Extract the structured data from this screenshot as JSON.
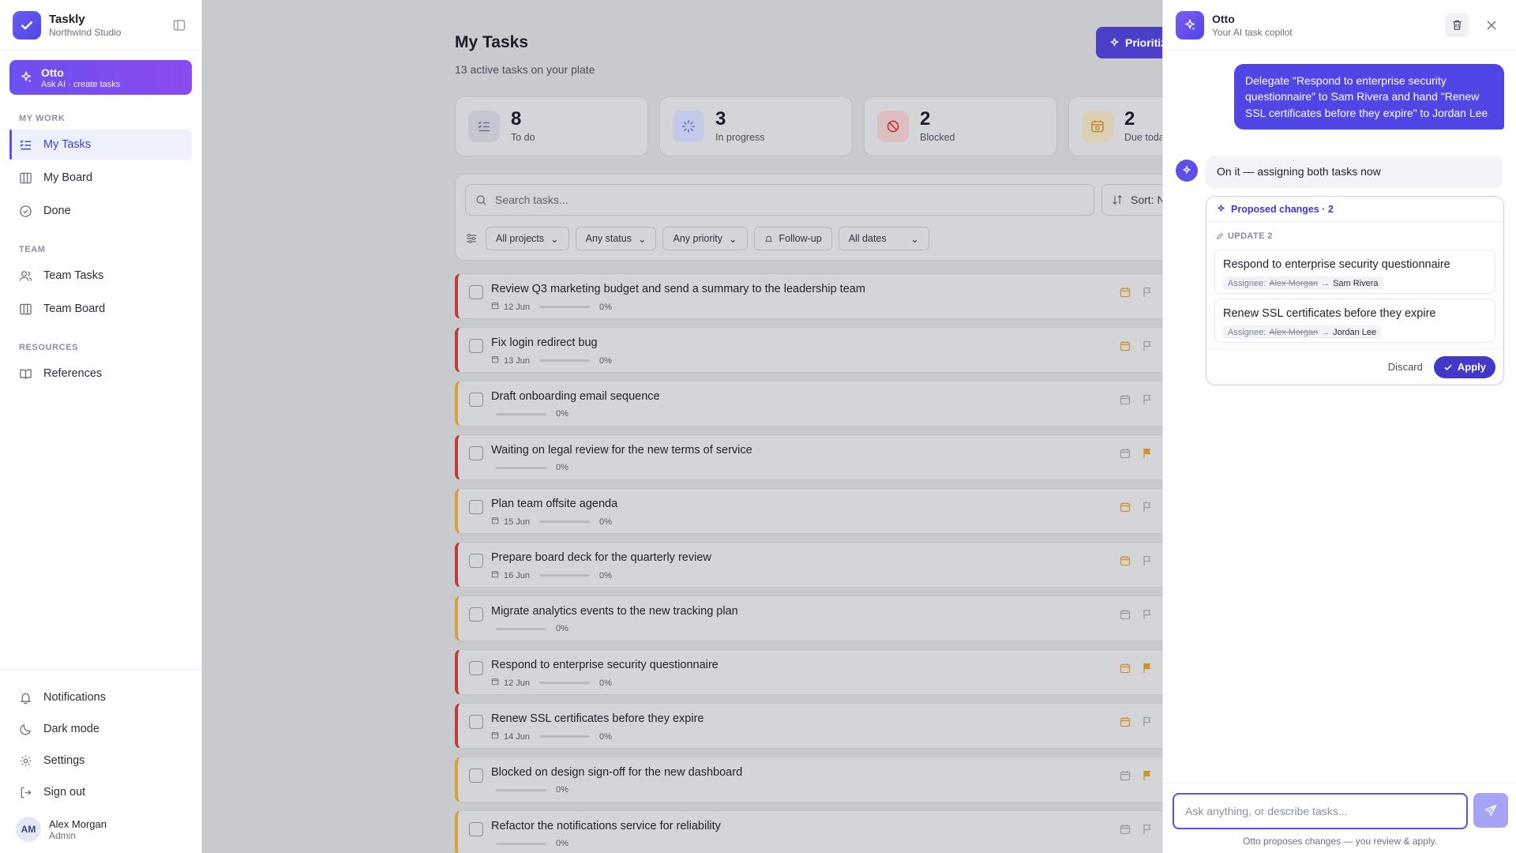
{
  "brand": {
    "name": "Taskly",
    "workspace": "Northwind Studio"
  },
  "otto_card": {
    "title": "Otto",
    "subtitle": "Ask AI · create tasks"
  },
  "nav": {
    "my_work_label": "MY WORK",
    "my_tasks": "My Tasks",
    "my_board": "My Board",
    "done": "Done",
    "team_label": "TEAM",
    "team_tasks": "Team Tasks",
    "team_board": "Team Board",
    "resources_label": "RESOURCES",
    "references": "References"
  },
  "footer_nav": {
    "notifications": "Notifications",
    "dark_mode": "Dark mode",
    "settings": "Settings",
    "sign_out": "Sign out"
  },
  "user": {
    "initials": "AM",
    "name": "Alex Morgan",
    "role": "Admin"
  },
  "page": {
    "title": "My Tasks",
    "subtitle": "13 active tasks on your plate",
    "prioritize_label": "Prioritiz"
  },
  "stats": [
    {
      "value": "8",
      "label": "To do",
      "color": "#8f97b8"
    },
    {
      "value": "3",
      "label": "In progress",
      "color": "#7d8fd8"
    },
    {
      "value": "2",
      "label": "Blocked",
      "color": "#c94848"
    },
    {
      "value": "2",
      "label": "Due toda",
      "color": "#c8973a"
    }
  ],
  "filters": {
    "search_placeholder": "Search tasks...",
    "sort_label": "Sort: N",
    "projects": "All projects",
    "status": "Any status",
    "priority": "Any priority",
    "follow_up": "Follow-up",
    "dates": "All dates"
  },
  "tasks": [
    {
      "title": "Review Q3 marketing budget and send a summary to the leadership team",
      "date": "12 Jun",
      "progress": "0%",
      "priority": "high",
      "flagged": false
    },
    {
      "title": "Fix login redirect bug",
      "date": "13 Jun",
      "progress": "0%",
      "priority": "high",
      "flagged": false
    },
    {
      "title": "Draft onboarding email sequence",
      "date": "",
      "progress": "0%",
      "priority": "medium",
      "flagged": false
    },
    {
      "title": "Waiting on legal review for the new terms of service",
      "date": "",
      "progress": "0%",
      "priority": "high",
      "flagged": true
    },
    {
      "title": "Plan team offsite agenda",
      "date": "15 Jun",
      "progress": "0%",
      "priority": "medium",
      "flagged": false
    },
    {
      "title": "Prepare board deck for the quarterly review",
      "date": "16 Jun",
      "progress": "0%",
      "priority": "high",
      "flagged": false
    },
    {
      "title": "Migrate analytics events to the new tracking plan",
      "date": "",
      "progress": "0%",
      "priority": "medium",
      "flagged": false
    },
    {
      "title": "Respond to enterprise security questionnaire",
      "date": "12 Jun",
      "progress": "0%",
      "priority": "high",
      "flagged": true
    },
    {
      "title": "Renew SSL certificates before they expire",
      "date": "14 Jun",
      "progress": "0%",
      "priority": "high",
      "flagged": false
    },
    {
      "title": "Blocked on design sign-off for the new dashboard",
      "date": "",
      "progress": "0%",
      "priority": "medium",
      "flagged": true
    },
    {
      "title": "Refactor the notifications service for reliability",
      "date": "",
      "progress": "0%",
      "priority": "medium",
      "flagged": false
    }
  ],
  "panel": {
    "title": "Otto",
    "subtitle": "Your AI task copilot",
    "user_message": "Delegate \"Respond to enterprise security questionnaire\" to Sam Rivera and hand \"Renew SSL certificates before they expire\" to Jordan Lee",
    "bot_message": "On it — assigning both tasks now",
    "proposal_title": "Proposed changes · 2",
    "update_label": "UPDATE 2",
    "changes": [
      {
        "task": "Respond to enterprise security questionnaire",
        "field": "Assignee:",
        "from": "Alex Morgan",
        "arrow": "→",
        "to": "Sam Rivera"
      },
      {
        "task": "Renew SSL certificates before they expire",
        "field": "Assignee:",
        "from": "Alex Morgan",
        "arrow": "→",
        "to": "Jordan Lee"
      }
    ],
    "discard_label": "Discard",
    "apply_label": "Apply",
    "input_placeholder": "Ask anything, or describe tasks...",
    "hint": "Otto proposes changes — you review & apply."
  }
}
